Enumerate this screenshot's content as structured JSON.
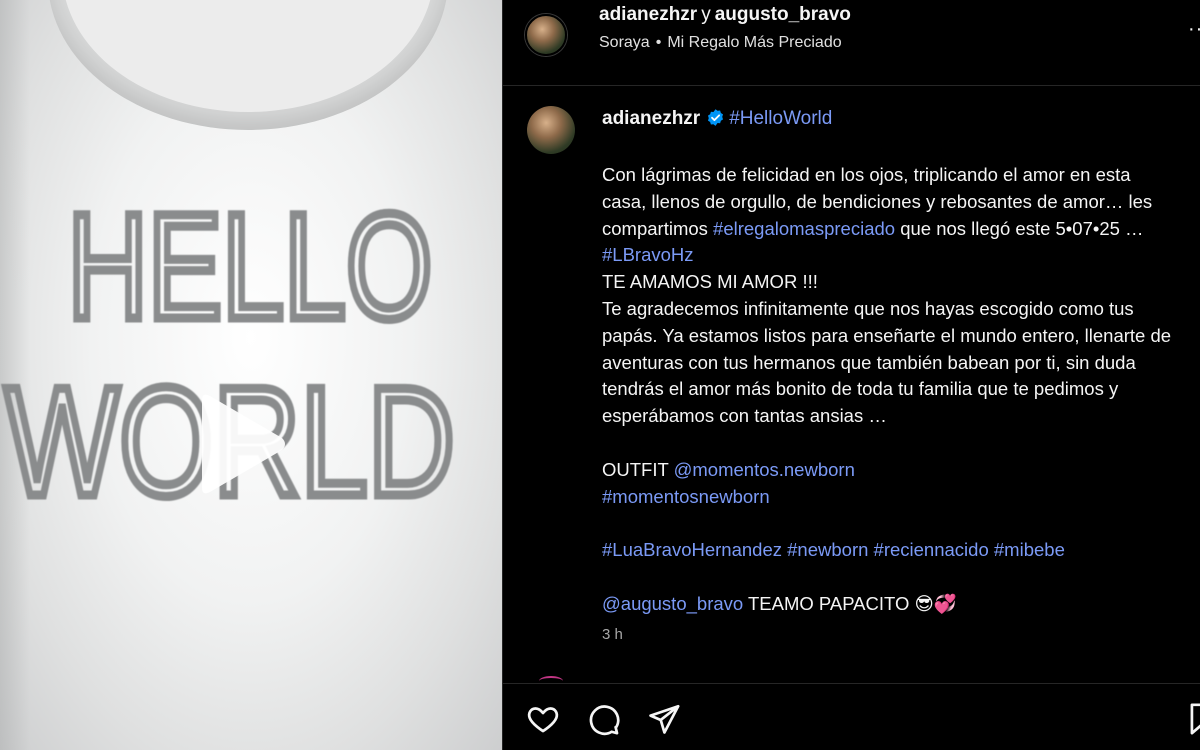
{
  "header": {
    "author": "adianezhzr",
    "conjunction": "y",
    "coauthor": "augusto_bravo",
    "audio_artist": "Soraya",
    "audio_dot": "•",
    "audio_title": "Mi Regalo Más Preciado",
    "more_label": "···"
  },
  "caption": {
    "username": "adianezhzr",
    "verified_icon": "verified-badge-icon",
    "head_tag": "#HelloWorld",
    "p1_text_a": "Con lágrimas de felicidad en los ojos, triplicando el amor en esta casa, llenos de orgullo, de bendiciones y rebosantes de amor… les compartimos ",
    "p1_tag_a": "#elregalomaspreciado",
    "p1_text_b": " que nos llegó este 5•07•25 … ",
    "p1_tag_b": "#LBravoHz",
    "line2": "TE AMAMOS MI AMOR !!!",
    "p3": "Te agradecemos infinitamente que nos hayas escogido como tus papás. Ya estamos listos para enseñarte el mundo entero, llenarte de aventuras con tus hermanos que también babean por ti, sin duda tendrás el amor más bonito de toda tu familia que te pedimos y esperábamos con tantas ansias …",
    "outfit_label": "OUTFIT ",
    "outfit_mention": "@momentos.newborn",
    "outfit_tag": "#momentosnewborn",
    "tags": [
      "#LuaBravoHernandez",
      "#newborn",
      "#reciennacido",
      "#mibebe"
    ],
    "final_mention": "@augusto_bravo",
    "final_text": " TEAMO PAPACITO ",
    "final_emojis": "😎💞",
    "timestamp": "3 h"
  },
  "media": {
    "shirt_line1": "HELLO",
    "shirt_line2": "WORLD",
    "play_icon": "play-icon"
  },
  "actions": {
    "like_icon": "heart-icon",
    "comment_icon": "comment-icon",
    "share_icon": "send-icon",
    "save_icon": "bookmark-icon"
  },
  "colors": {
    "background": "#000000",
    "link": "#7b9af6",
    "verified": "#0095f6",
    "muted": "#a8a8a8",
    "embroidery": "#8a8c8d"
  }
}
